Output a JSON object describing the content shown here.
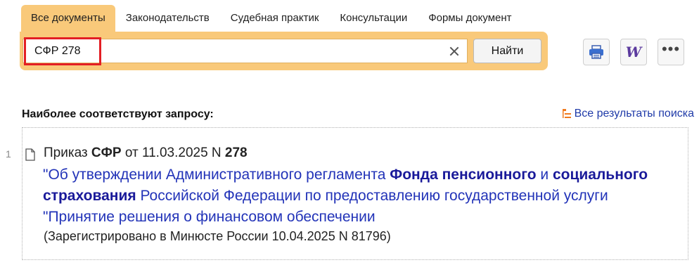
{
  "tabs": [
    {
      "label": "Все документы",
      "active": true
    },
    {
      "label": "Законодательств",
      "active": false
    },
    {
      "label": "Судебная практик",
      "active": false
    },
    {
      "label": "Консультации",
      "active": false
    },
    {
      "label": "Формы документ",
      "active": false
    }
  ],
  "search": {
    "value": "СФР 278",
    "find_label": "Найти"
  },
  "toolbar": {
    "print_icon": "print-icon",
    "word_label": "W",
    "more_label": "•••"
  },
  "results": {
    "title": "Наиболее соответствуют запросу:",
    "all_results_label": "Все результаты поиска",
    "items": [
      {
        "number": "1",
        "line1": {
          "pre": "Приказ ",
          "bold1": "СФР",
          "mid": " от 11.03.2025 N ",
          "bold2": "278"
        },
        "body": {
          "t1": "\"Об утверждении Административного регламента ",
          "b1": "Фонда пенсионного",
          "t2": " и ",
          "b2": "социального страхования",
          "t3": " Российской Федерации по предоставлению государственной услуги \"Принятие решения о финансовом обеспечении"
        },
        "note": "(Зарегистрировано в Минюсте России 10.04.2025 N 81796)"
      }
    ]
  },
  "colors": {
    "accent": "#f9c97a",
    "link": "#2233b8",
    "highlight_border": "#e31e24"
  }
}
